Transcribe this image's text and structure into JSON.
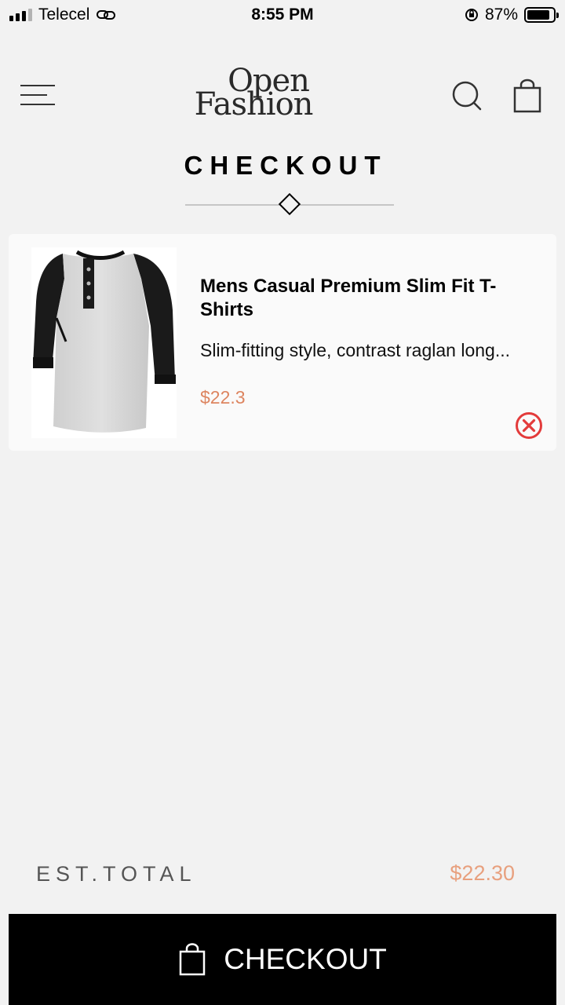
{
  "status_bar": {
    "carrier": "Telecel",
    "time": "8:55 PM",
    "battery": "87%",
    "battery_level": 0.87
  },
  "header": {
    "logo_line1": "Open",
    "logo_line2": "Fashion",
    "icons": [
      "menu-icon",
      "search-icon",
      "shopping-bag-icon"
    ]
  },
  "page": {
    "title": "CHECKOUT"
  },
  "cart": {
    "items": [
      {
        "name": "Mens Casual Premium Slim Fit T-Shirts",
        "description": "Slim-fitting style, contrast raglan long...",
        "price": "$22.3"
      }
    ]
  },
  "summary": {
    "total_label": "EST.TOTAL",
    "total_value": "$22.30"
  },
  "checkout_button": {
    "label": "CHECKOUT"
  },
  "colors": {
    "accent_price": "#dd8560",
    "total": "#e8a07e",
    "remove": "#e33b3b",
    "background": "#f2f2f2"
  }
}
